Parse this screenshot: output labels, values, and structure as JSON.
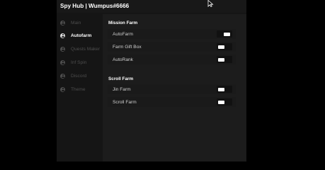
{
  "window": {
    "title": "Spy Hub | Wumpus#6666"
  },
  "sidebar": {
    "items": [
      {
        "label": "Main",
        "active": false
      },
      {
        "label": "Autofarm",
        "active": true
      },
      {
        "label": "Quests Maker",
        "active": false
      },
      {
        "label": "Inf Spin",
        "active": false
      },
      {
        "label": "Discord",
        "active": false
      },
      {
        "label": "Theme",
        "active": false
      }
    ]
  },
  "sections": [
    {
      "title": "Mission Farm",
      "toggles": [
        {
          "label": "AutoFarm",
          "on": true
        },
        {
          "label": "Farm Gift Box",
          "on": false
        },
        {
          "label": "AutoRank",
          "on": false
        }
      ]
    },
    {
      "title": "Scroll Farm",
      "toggles": [
        {
          "label": "Jin Farm",
          "on": false
        },
        {
          "label": "Scroll Farm",
          "on": false
        }
      ]
    }
  ],
  "icons": {
    "nav": "user-circle-icon",
    "cursor": "mouse-cursor-icon"
  },
  "colors": {
    "background": "#000000",
    "panel": "#151515",
    "content": "#1c1c1c",
    "active": "#ffffff",
    "inactive": "#4d4d4d"
  }
}
